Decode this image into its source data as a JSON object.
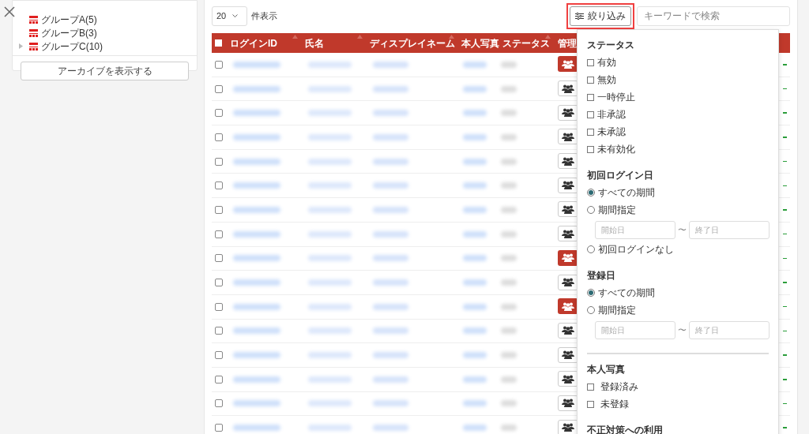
{
  "sidebar": {
    "tree": [
      {
        "label": "グループA(5)",
        "has_children": false
      },
      {
        "label": "グループB(3)",
        "has_children": false
      },
      {
        "label": "グループC(10)",
        "has_children": true
      }
    ],
    "archive_button": "アーカイブを表示する"
  },
  "toolbar": {
    "page_size": "20",
    "page_size_suffix": "件表示",
    "filter_button": {
      "label": "絞り込み",
      "highlighted": true
    },
    "search": {
      "placeholder": "キーワードで検索"
    }
  },
  "table": {
    "header_checkbox": {
      "checked": false
    },
    "columns": [
      {
        "label": "ログインID",
        "sortable": true
      },
      {
        "label": "氏名",
        "sortable": true
      },
      {
        "label": "ディスプレイネーム",
        "sortable": true
      },
      {
        "label": "本人写真",
        "sortable": false
      },
      {
        "label": "ステータス",
        "sortable": true
      },
      {
        "label": "管理",
        "sortable": false
      }
    ],
    "rows": [
      {
        "admin": true,
        "checked": false
      },
      {
        "admin": false,
        "checked": false
      },
      {
        "admin": false,
        "checked": false
      },
      {
        "admin": false,
        "checked": false
      },
      {
        "admin": false,
        "checked": false
      },
      {
        "admin": false,
        "checked": false
      },
      {
        "admin": false,
        "checked": false
      },
      {
        "admin": false,
        "checked": false
      },
      {
        "admin": true,
        "checked": false
      },
      {
        "admin": false,
        "checked": false
      },
      {
        "admin": true,
        "checked": false
      },
      {
        "admin": false,
        "checked": false
      },
      {
        "admin": false,
        "checked": false
      },
      {
        "admin": false,
        "checked": false
      },
      {
        "admin": false,
        "checked": false
      },
      {
        "admin": false,
        "checked": false
      }
    ]
  },
  "filter_panel": {
    "sections": [
      {
        "title": "ステータス",
        "divider": false,
        "items": [
          {
            "kind": "checkbox",
            "label": "有効",
            "checked": false
          },
          {
            "kind": "checkbox",
            "label": "無効",
            "checked": false
          },
          {
            "kind": "checkbox",
            "label": "一時停止",
            "checked": false
          },
          {
            "kind": "checkbox",
            "label": "非承認",
            "checked": false
          },
          {
            "kind": "checkbox",
            "label": "未承認",
            "checked": false
          },
          {
            "kind": "checkbox",
            "label": "未有効化",
            "checked": false
          }
        ]
      },
      {
        "title": "初回ログイン日",
        "divider": false,
        "items": [
          {
            "kind": "radio",
            "label": "すべての期間",
            "selected": true
          },
          {
            "kind": "radio",
            "label": "期間指定",
            "selected": false
          },
          {
            "kind": "date_range",
            "start_placeholder": "開始日",
            "separator": "〜",
            "end_placeholder": "終了日"
          },
          {
            "kind": "radio",
            "label": "初回ログインなし",
            "selected": false
          }
        ]
      },
      {
        "title": "登録日",
        "divider": false,
        "items": [
          {
            "kind": "radio",
            "label": "すべての期間",
            "selected": true
          },
          {
            "kind": "radio",
            "label": "期間指定",
            "selected": false
          },
          {
            "kind": "date_range",
            "start_placeholder": "開始日",
            "separator": "〜",
            "end_placeholder": "終了日"
          }
        ]
      },
      {
        "title": "本人写真",
        "divider": true,
        "items": [
          {
            "kind": "checkbox_wide",
            "label": "登録済み",
            "checked": false
          },
          {
            "kind": "checkbox_wide",
            "label": "未登録",
            "checked": false
          }
        ]
      },
      {
        "title": "不正対策への利用",
        "divider": false
      }
    ]
  }
}
